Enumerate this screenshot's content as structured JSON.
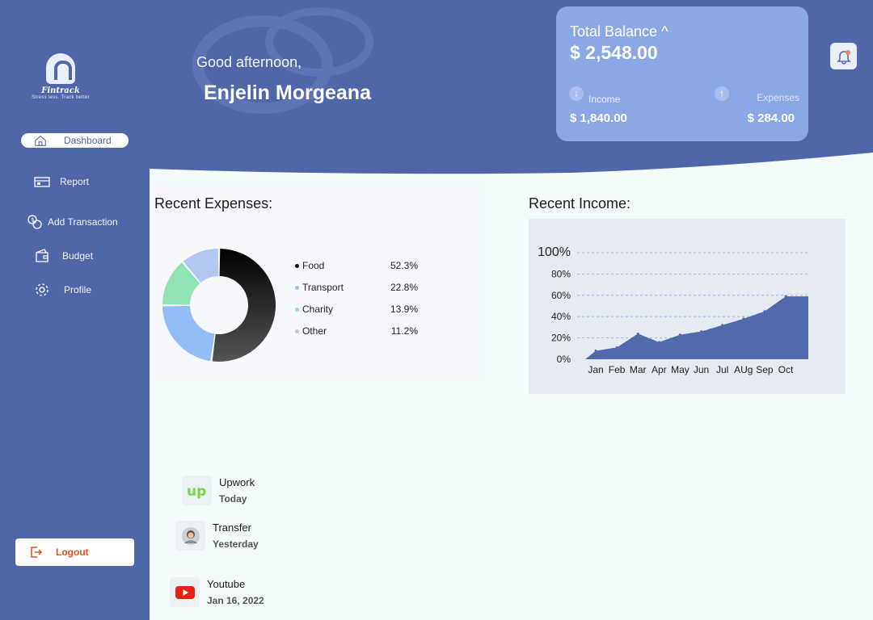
{
  "brand": {
    "name": "Fintrack",
    "tagline": "Stress less. Track better"
  },
  "sidebar": {
    "items": [
      {
        "label": "Dashboard",
        "icon": "home-icon",
        "active": true
      },
      {
        "label": "Report",
        "icon": "report-icon"
      },
      {
        "label": "Add Transaction",
        "icon": "add-transaction-icon"
      },
      {
        "label": "Budget",
        "icon": "wallet-icon"
      },
      {
        "label": "Profile",
        "icon": "gear-icon"
      }
    ],
    "logout_label": "Logout"
  },
  "header": {
    "greeting": "Good afternoon,",
    "user_name": "Enjelin Morgeana"
  },
  "balance": {
    "title": "Total Balance ^",
    "total": "$ 2,548.00",
    "income_label": "Income",
    "income_value": "$ 1,840.00",
    "expenses_label": "Expenses",
    "expenses_value": "$ 284.00"
  },
  "expenses": {
    "title": "Recent Expenses:",
    "items": [
      {
        "label": "Food",
        "pct": "52.3%"
      },
      {
        "label": "Transport",
        "pct": "22.8%"
      },
      {
        "label": "Charity",
        "pct": "13.9%"
      },
      {
        "label": "Other",
        "pct": "11.2%"
      }
    ]
  },
  "income": {
    "title": "Recent Income:"
  },
  "transactions": [
    {
      "name": "Upwork",
      "date": "Today",
      "icon": "upwork-icon"
    },
    {
      "name": "Transfer",
      "date": "Yesterday",
      "icon": "avatar-icon"
    },
    {
      "name": "Youtube",
      "date": "Jan 16, 2022",
      "icon": "youtube-icon"
    }
  ],
  "colors": {
    "sidebar": "#4f67a8",
    "card": "#8aa7e6",
    "food": "#111111",
    "transport": "#93bdf9",
    "charity": "#8fe3b4",
    "other": "#b2c8f1",
    "income_area": "#5169ad",
    "logout": "#e94d1c"
  },
  "chart_data": [
    {
      "type": "pie",
      "title": "Recent Expenses:",
      "categories": [
        "Food",
        "Transport",
        "Charity",
        "Other"
      ],
      "values": [
        52.3,
        22.8,
        13.9,
        11.2
      ]
    },
    {
      "type": "area",
      "title": "Recent Income:",
      "x": [
        "Jan",
        "Feb",
        "Mar",
        "Apr",
        "May",
        "Jun",
        "Jul",
        "AUg",
        "Sep",
        "Oct"
      ],
      "y": [
        8,
        11,
        24,
        16,
        23,
        26,
        32,
        38,
        45,
        59
      ],
      "ylim": [
        0,
        100
      ],
      "yticks": [
        "0%",
        "20%",
        "40%",
        "60%",
        "80%",
        "100%"
      ],
      "ytick_values": [
        0,
        20,
        40,
        60,
        80,
        100
      ],
      "grid": true
    }
  ]
}
